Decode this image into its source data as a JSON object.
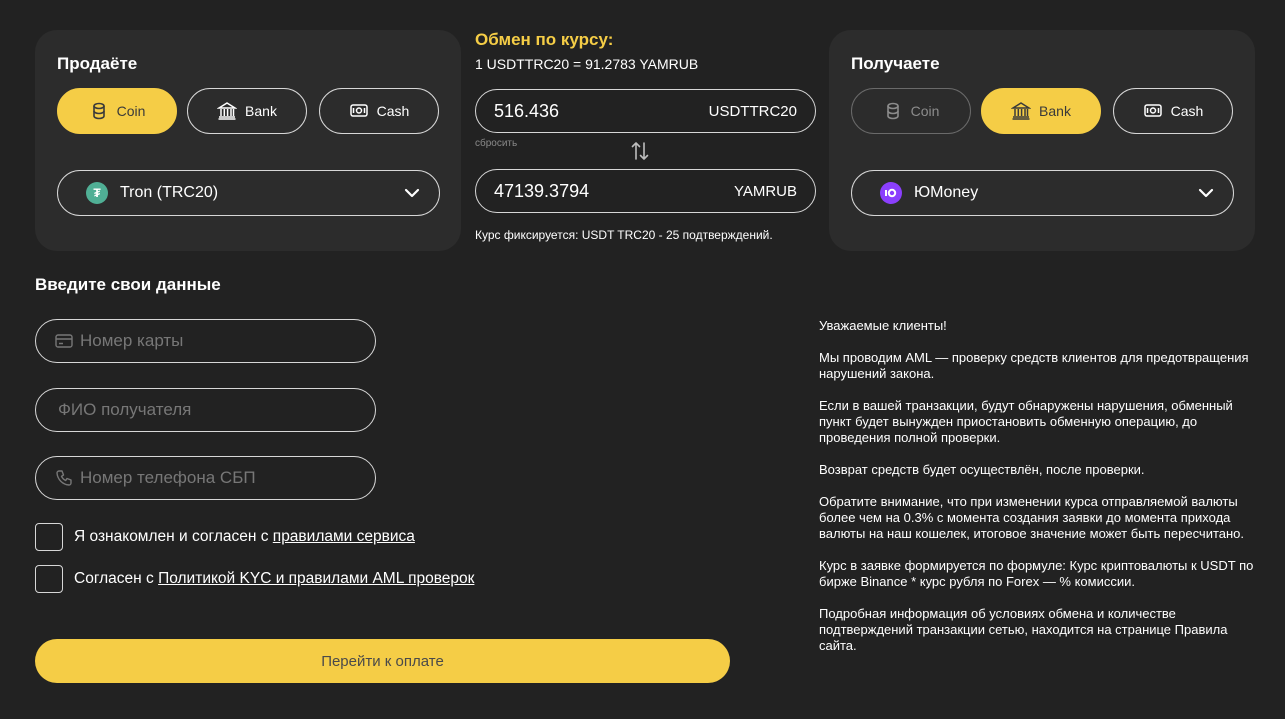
{
  "sell": {
    "title": "Продаёте",
    "segments": [
      {
        "label": "Coin",
        "icon": "coin-icon",
        "state": "active"
      },
      {
        "label": "Bank",
        "icon": "bank-icon",
        "state": "normal"
      },
      {
        "label": "Cash",
        "icon": "cash-icon",
        "state": "normal"
      }
    ],
    "selected": "Tron (TRC20)",
    "selected_icon": "tether-icon",
    "selected_icon_color": "#50af95"
  },
  "exchange": {
    "title": "Обмен по курсу:",
    "rate": "1 USDTTRC20 = 91.2783 YAMRUB",
    "give_amount": "516.436",
    "give_currency": "USDTTRC20",
    "reset_label": "сбросить",
    "get_amount": "47139.3794",
    "get_currency": "YAMRUB",
    "note": "Курс фиксируется: USDT TRC20 - 25 подтверждений."
  },
  "receive": {
    "title": "Получаете",
    "segments": [
      {
        "label": "Coin",
        "icon": "coin-icon",
        "state": "disabled"
      },
      {
        "label": "Bank",
        "icon": "bank-icon",
        "state": "active"
      },
      {
        "label": "Cash",
        "icon": "cash-icon",
        "state": "normal"
      }
    ],
    "selected": "ЮMoney",
    "selected_icon": "yoomoney-icon",
    "selected_icon_color": "#8b3ffd"
  },
  "form": {
    "title": "Введите свои данные",
    "card_placeholder": "Номер карты",
    "name_placeholder": "ФИО получателя",
    "phone_placeholder": "Номер телефона СБП",
    "agree1_text": "Я ознакомлен и согласен с ",
    "agree1_link": "правилами сервиса",
    "agree2_text": "Согласен с ",
    "agree2_link": "Политикой KYC и правилами AML проверок",
    "pay_label": "Перейти к оплате"
  },
  "info": {
    "paragraphs": [
      "Уважаемые клиенты!",
      "Мы проводим AML — проверку средств клиентов для предотвращения нарушений закона.",
      "Если в вашей транзакции, будут обнаружены нарушения, обменный пункт будет вынужден приостановить обменную операцию, до проведения полной проверки.",
      "Возврат средств будет осуществлён, после проверки.",
      "Обратите внимание, что при изменении курса отправляемой валюты более чем на 0.3% с момента создания заявки до момента прихода валюты на наш кошелек, итоговое значение может быть пересчитано.",
      "Курс в заявке формируется по формуле: Курс криптовалюты к USDT по бирже Binance * курс рубля по Forex — % комиссии.",
      "Подробная информация об условиях обмена и количестве подтверждений транзакции сетью, находится на странице Правила сайта."
    ]
  },
  "colors": {
    "accent": "#f5cd46",
    "background": "#222222",
    "card": "#2c2c2c"
  }
}
